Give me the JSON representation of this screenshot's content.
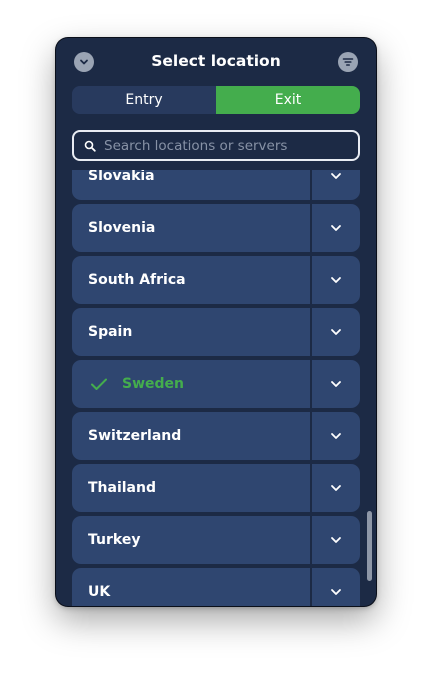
{
  "header": {
    "title": "Select location",
    "close_icon": "chevron-down-icon",
    "filter_icon": "filter-icon"
  },
  "tabs": [
    {
      "label": "Entry",
      "active": false
    },
    {
      "label": "Exit",
      "active": true
    }
  ],
  "search": {
    "placeholder": "Search locations or servers",
    "icon": "search-icon"
  },
  "locations": [
    {
      "name": "Slovakia",
      "selected": false
    },
    {
      "name": "Slovenia",
      "selected": false
    },
    {
      "name": "South Africa",
      "selected": false
    },
    {
      "name": "Spain",
      "selected": false
    },
    {
      "name": "Sweden",
      "selected": true
    },
    {
      "name": "Switzerland",
      "selected": false
    },
    {
      "name": "Thailand",
      "selected": false
    },
    {
      "name": "Turkey",
      "selected": false
    },
    {
      "name": "UK",
      "selected": false
    }
  ],
  "colors": {
    "background": "#1c2a45",
    "row": "#2f4670",
    "accent_green": "#44ad4d",
    "text": "#ffffff"
  }
}
